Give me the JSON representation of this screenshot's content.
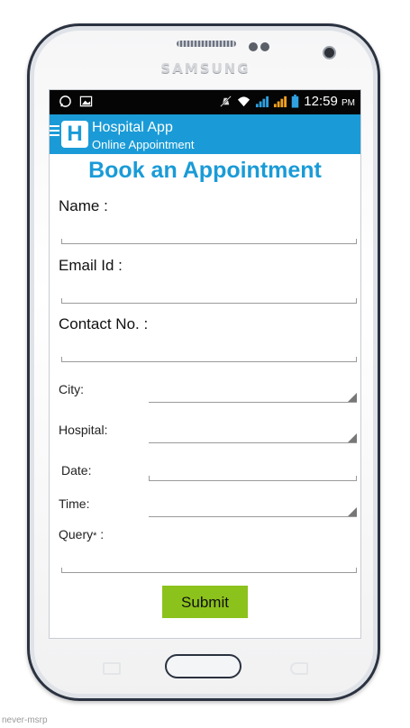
{
  "device": {
    "brand": "SAMSUNG"
  },
  "status_bar": {
    "time": "12:59",
    "ampm": "PM"
  },
  "app_bar": {
    "logo_letter": "H",
    "title": "Hospital App",
    "subtitle": "Online Appointment"
  },
  "form": {
    "heading": "Book an Appointment",
    "name_label": "Name :",
    "name_value": "",
    "email_label": "Email Id :",
    "email_value": "",
    "contact_label": "Contact No. :",
    "contact_value": "",
    "city_label": "City:",
    "city_value": "",
    "hospital_label": "Hospital:",
    "hospital_value": "",
    "date_label": "Date:",
    "date_value": "",
    "time_label": "Time:",
    "time_value": "",
    "query_label": "Query",
    "query_marker": "*",
    "query_suffix": " :",
    "query_value": "",
    "submit_label": "Submit"
  },
  "colors": {
    "primary": "#1a9bd7",
    "submit": "#8cc21c",
    "status_bar": "#050505"
  },
  "icons": [
    "whatsapp-icon",
    "gallery-icon",
    "mute-icon",
    "wifi-icon",
    "signal-icon",
    "battery-icon",
    "menu-icon"
  ],
  "watermark": "never-msrp"
}
